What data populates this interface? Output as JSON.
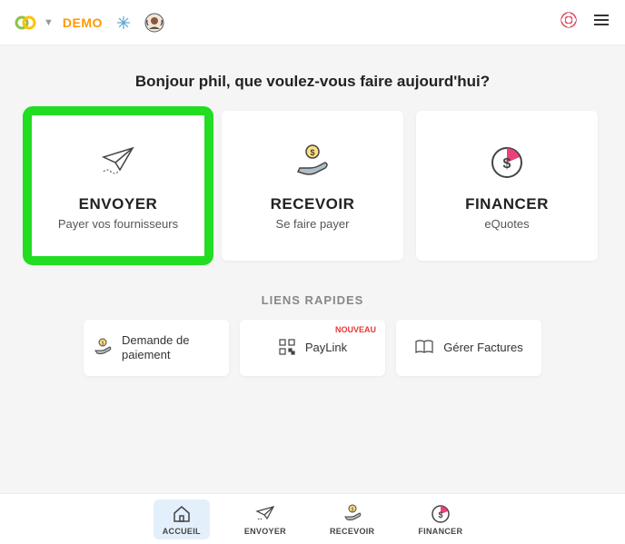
{
  "topbar": {
    "demo_label": "DEMO"
  },
  "greeting": "Bonjour phil, que voulez-vous faire aujourd'hui?",
  "cards": {
    "send": {
      "title": "ENVOYER",
      "sub": "Payer vos fournisseurs"
    },
    "receive": {
      "title": "RECEVOIR",
      "sub": "Se faire payer"
    },
    "finance": {
      "title": "FINANCER",
      "sub": "eQuotes"
    }
  },
  "quick": {
    "title": "LIENS RAPIDES",
    "pay_request": "Demande de paiement",
    "paylink": "PayLink",
    "paylink_badge": "NOUVEAU",
    "invoices": "Gérer Factures"
  },
  "nav": {
    "home": "ACCUEIL",
    "send": "ENVOYER",
    "receive": "RECEVOIR",
    "finance": "FINANCER"
  }
}
